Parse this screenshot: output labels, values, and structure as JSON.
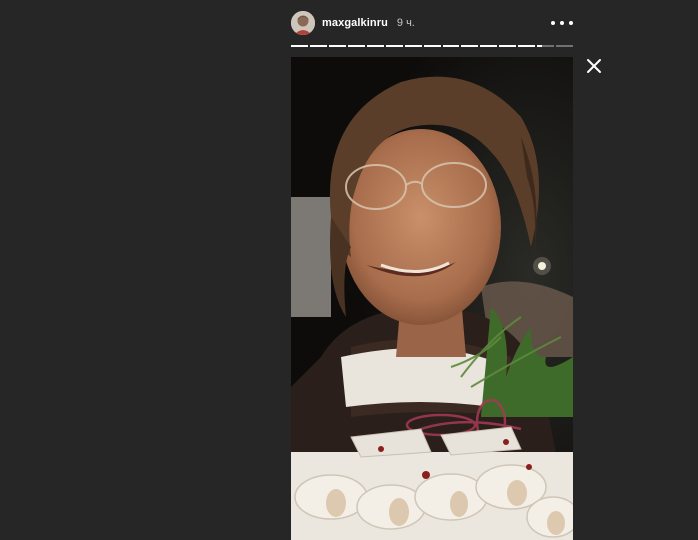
{
  "story": {
    "username": "maxgalkinru",
    "time_ago": "9 ч.",
    "segments_total": 15,
    "current_segment": 14,
    "current_segment_progress": 0.3
  },
  "icons": {
    "more": "more-horizontal-icon",
    "close": "close-icon"
  },
  "colors": {
    "background": "#262626",
    "text": "#ffffff",
    "muted_text": "#c7c7c7"
  }
}
